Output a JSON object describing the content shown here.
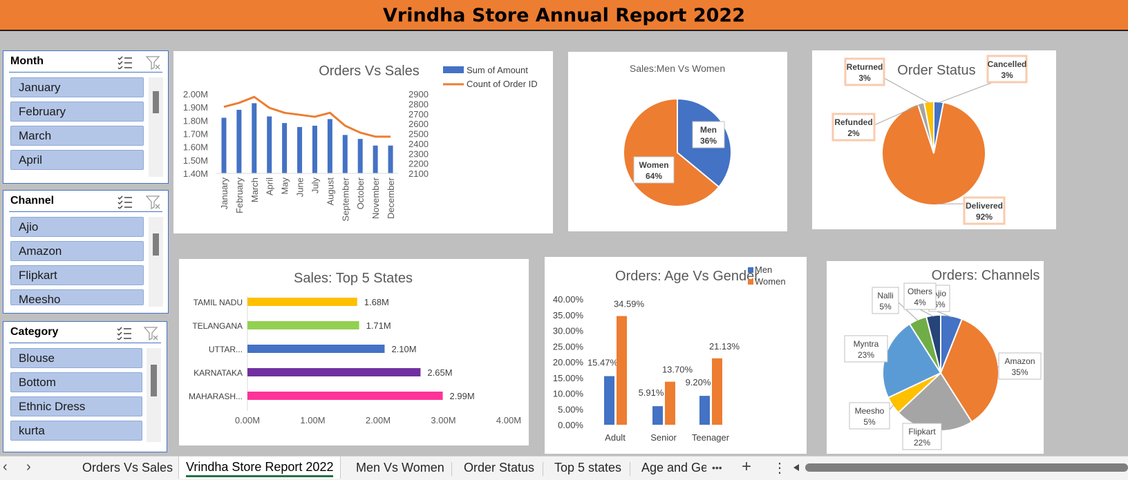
{
  "report_title": "Vrindha Store Annual Report 2022",
  "slicers": [
    {
      "header": "Month",
      "items": [
        "January",
        "February",
        "March",
        "April"
      ]
    },
    {
      "header": "Channel",
      "items": [
        "Ajio",
        "Amazon",
        "Flipkart",
        "Meesho"
      ]
    },
    {
      "header": "Category",
      "items": [
        "Blouse",
        "Bottom",
        "Ethnic Dress",
        "kurta"
      ]
    }
  ],
  "icons": [
    "multi-select-icon",
    "clear-filter-icon",
    "scroll-left-icon",
    "scroll-right-icon",
    "more-tabs-icon",
    "add-sheet-icon",
    "sheet-options-icon",
    "scroll-bar-left-icon"
  ],
  "tabs": {
    "items": [
      "Orders Vs Sales",
      "Vrindha Store Report 2022",
      "Men Vs Women",
      "Order Status",
      "Top 5 states",
      "Age and Ger"
    ],
    "active": "Vrindha Store Report 2022",
    "prev": "‹",
    "next": "›",
    "more": "•••",
    "add": "+",
    "menu": "⋮"
  },
  "chart_data": [
    {
      "type": "line",
      "title": "Orders Vs Sales",
      "categories": [
        "January",
        "February",
        "March",
        "April",
        "May",
        "June",
        "July",
        "August",
        "September",
        "October",
        "November",
        "December"
      ],
      "series": [
        {
          "name": "Sum of Amount",
          "chart": "bar",
          "axis": "left",
          "color": "#4472c4",
          "values": [
            1.82,
            1.88,
            1.93,
            1.83,
            1.78,
            1.75,
            1.76,
            1.81,
            1.69,
            1.66,
            1.61,
            1.61
          ]
        },
        {
          "name": "Count of Order ID",
          "chart": "line",
          "axis": "right",
          "color": "#ed7d31",
          "values": [
            2770,
            2810,
            2870,
            2760,
            2710,
            2690,
            2670,
            2710,
            2580,
            2510,
            2470,
            2470
          ]
        }
      ],
      "ylim_left": [
        1.4,
        2.0
      ],
      "ylim_right": [
        2100,
        2900
      ],
      "yticks_left": [
        "2.00M",
        "1.90M",
        "1.80M",
        "1.70M",
        "1.60M",
        "1.50M",
        "1.40M"
      ],
      "yticks_right": [
        "2900",
        "2800",
        "2700",
        "2600",
        "2500",
        "2400",
        "2300",
        "2200",
        "2100"
      ]
    },
    {
      "type": "pie",
      "title": "Sales:Men Vs Women",
      "slices": [
        {
          "label": "Men",
          "value": 36,
          "pct": "36%",
          "color": "#4472c4"
        },
        {
          "label": "Women",
          "value": 64,
          "pct": "64%",
          "color": "#ed7d31"
        }
      ]
    },
    {
      "type": "pie",
      "title": "Order Status",
      "slices": [
        {
          "label": "Cancelled",
          "value": 3,
          "pct": "3%",
          "color": "#4472c4"
        },
        {
          "label": "Delivered",
          "value": 92,
          "pct": "92%",
          "color": "#ed7d31"
        },
        {
          "label": "Refunded",
          "value": 2,
          "pct": "2%",
          "color": "#a5a5a5"
        },
        {
          "label": "Returned",
          "value": 3,
          "pct": "3%",
          "color": "#ffc000"
        }
      ]
    },
    {
      "type": "bar",
      "orientation": "horizontal",
      "title": "Sales: Top 5 States",
      "categories": [
        "TAMIL NADU",
        "TELANGANA",
        "UTTAR...",
        "KARNATAKA",
        "MAHARASH..."
      ],
      "values": [
        1.68,
        1.71,
        2.1,
        2.65,
        2.99
      ],
      "labels": [
        "1.68M",
        "1.71M",
        "2.10M",
        "2.65M",
        "2.99M"
      ],
      "colors": [
        "#ffc000",
        "#92d050",
        "#4472c4",
        "#7030a0",
        "#ff3399"
      ],
      "xlim": [
        0,
        4
      ],
      "xticks": [
        "0.00M",
        "1.00M",
        "2.00M",
        "3.00M",
        "4.00M"
      ]
    },
    {
      "type": "bar",
      "title": "Orders: Age Vs Gender",
      "categories": [
        "Adult",
        "Senior",
        "Teenager"
      ],
      "series": [
        {
          "name": "Men",
          "color": "#4472c4",
          "values": [
            15.47,
            5.91,
            9.2
          ],
          "labels": [
            "15.47%",
            "5.91%",
            "9.20%"
          ]
        },
        {
          "name": "Women",
          "color": "#ed7d31",
          "values": [
            34.59,
            13.7,
            21.13
          ],
          "labels": [
            "34.59%",
            "13.70%",
            "21.13%"
          ]
        }
      ],
      "ylim": [
        0,
        40
      ],
      "yticks": [
        "40.00%",
        "35.00%",
        "30.00%",
        "25.00%",
        "20.00%",
        "15.00%",
        "10.00%",
        "5.00%",
        "0.00%"
      ]
    },
    {
      "type": "pie",
      "title": "Orders: Channels",
      "slices": [
        {
          "label": "Ajio",
          "value": 6,
          "pct": "6%",
          "color": "#4472c4"
        },
        {
          "label": "Amazon",
          "value": 35,
          "pct": "35%",
          "color": "#ed7d31"
        },
        {
          "label": "Flipkart",
          "value": 22,
          "pct": "22%",
          "color": "#a5a5a5"
        },
        {
          "label": "Meesho",
          "value": 5,
          "pct": "5%",
          "color": "#ffc000"
        },
        {
          "label": "Myntra",
          "value": 23,
          "pct": "23%",
          "color": "#5b9bd5"
        },
        {
          "label": "Nalli",
          "value": 5,
          "pct": "5%",
          "color": "#70ad47"
        },
        {
          "label": "Others",
          "value": 4,
          "pct": "4%",
          "color": "#264478"
        }
      ]
    }
  ]
}
